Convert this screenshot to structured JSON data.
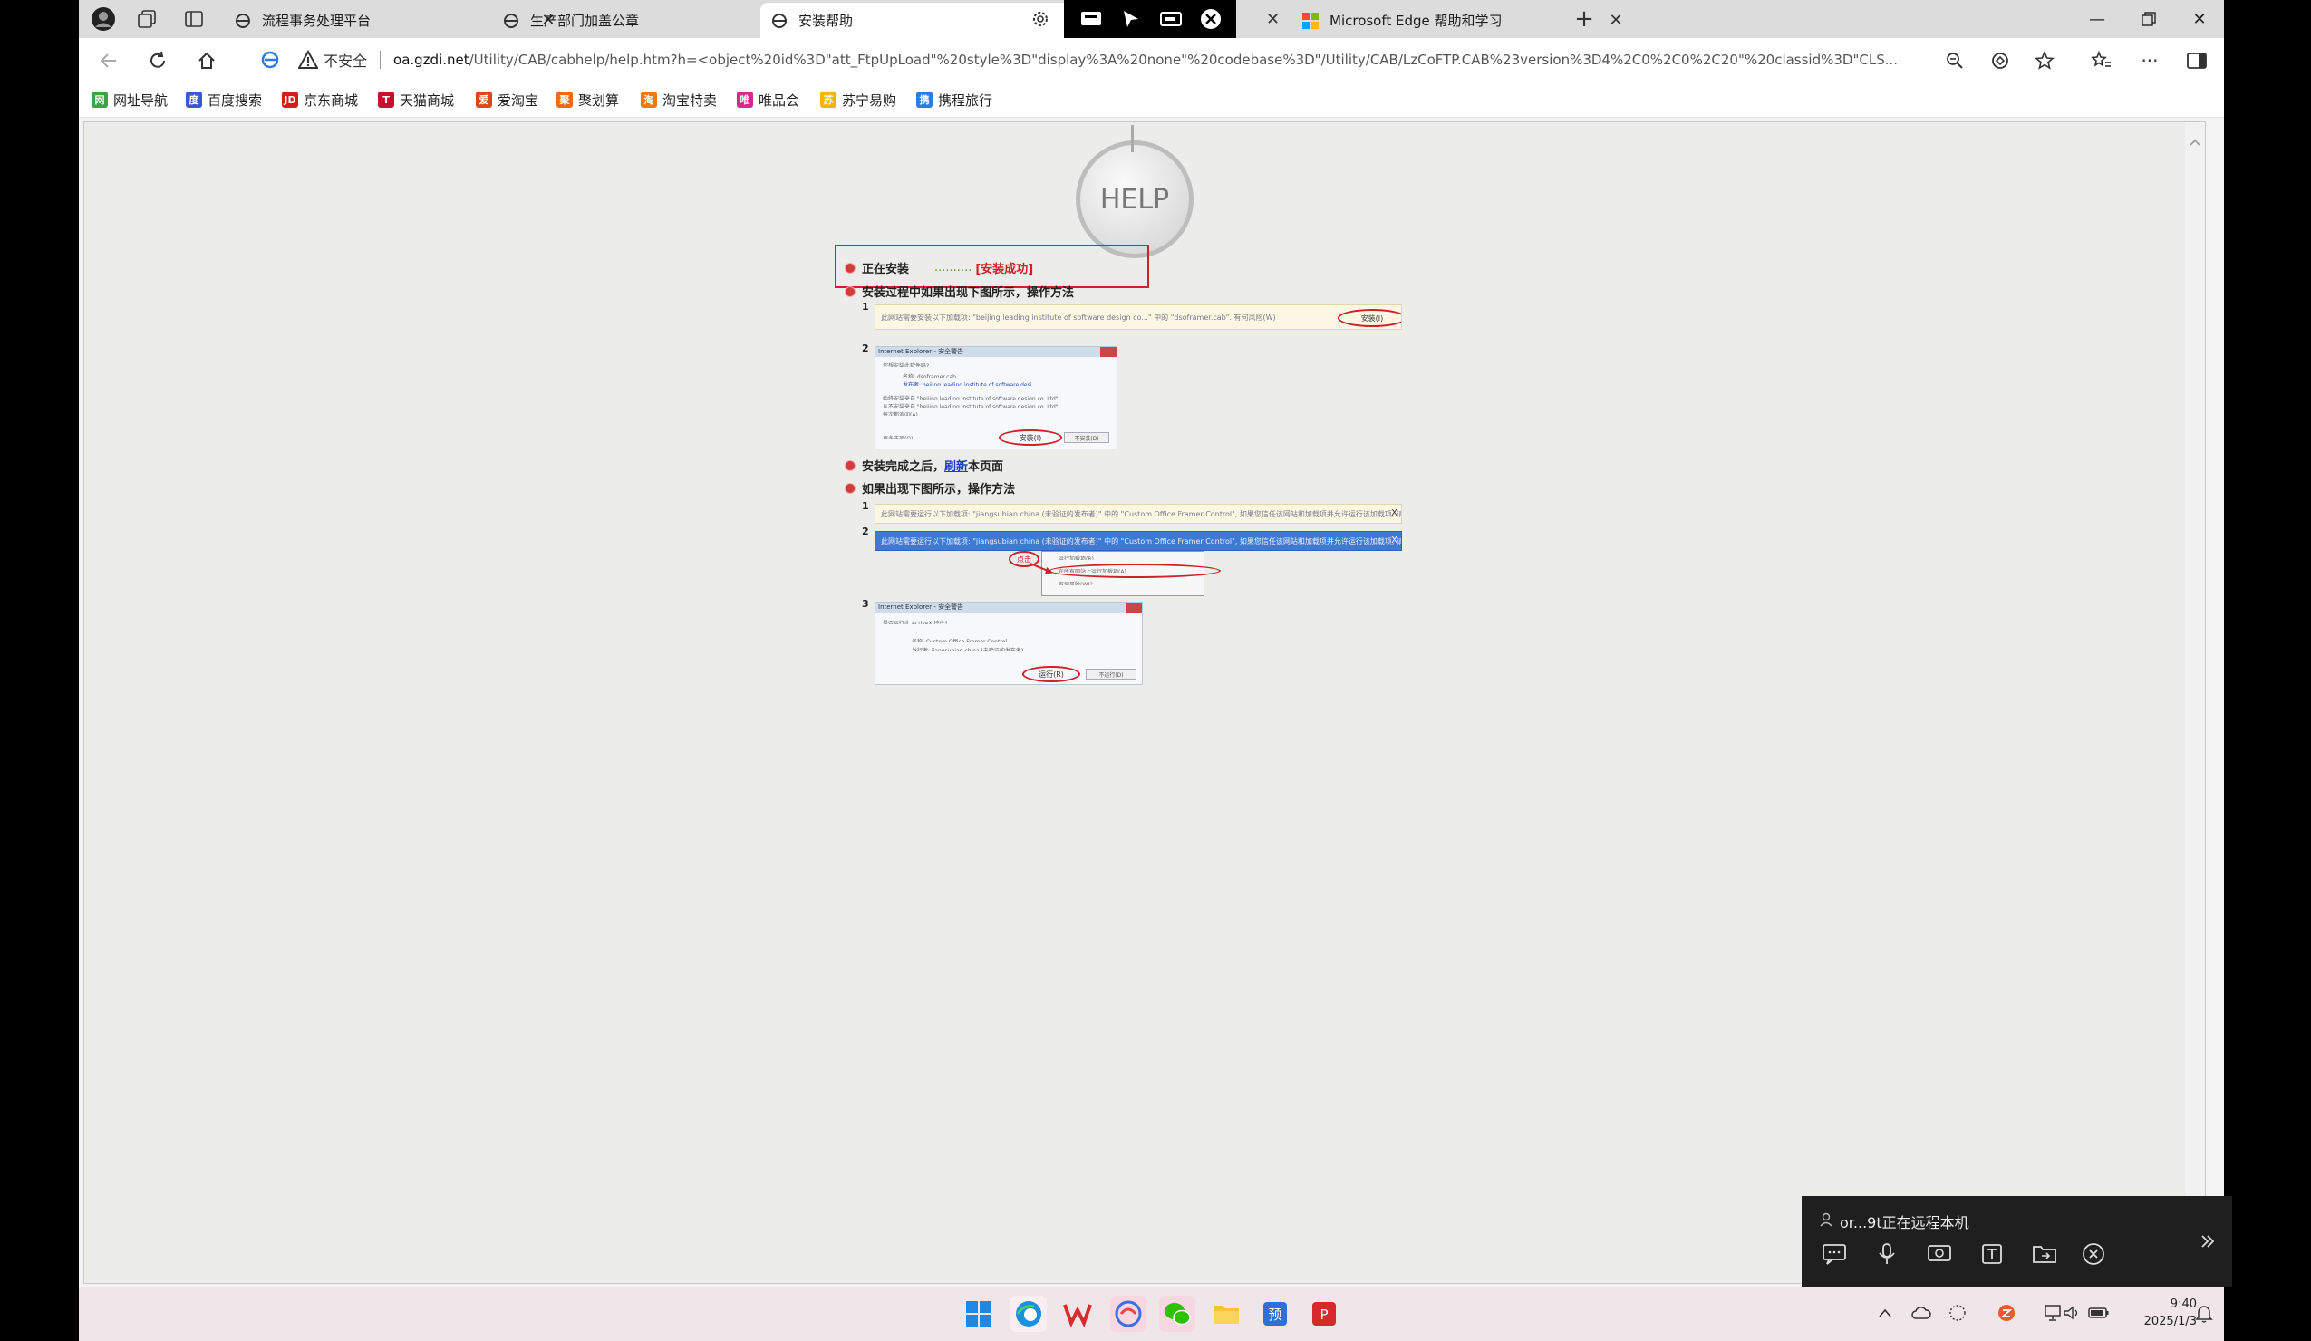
{
  "tabs": [
    {
      "title": "流程事务处理平台",
      "active": false
    },
    {
      "title": "生产部门加盖公章",
      "active": false
    },
    {
      "title": "安装帮助",
      "active": true
    },
    {
      "title": "Microsoft Edge 帮助和学习",
      "active": false
    }
  ],
  "address": {
    "security_label": "不安全",
    "url_host": "oa.gzdi.net",
    "url_path": "/Utility/CAB/cabhelp/help.htm?h=<object%20id%3D\"att_FtpUpLoad\"%20style%3D\"display%3A%20none\"%20codebase%3D\"/Utility/CAB/LzCoFTP.CAB%23version%3D4%2C0%2C0%2C20\"%20classid%3D\"CLS..."
  },
  "favorites": [
    {
      "label": "网址导航",
      "color": "#3aa34a",
      "glyph": "网"
    },
    {
      "label": "百度搜索",
      "color": "#3b57d6",
      "glyph": "度"
    },
    {
      "label": "京东商城",
      "color": "#d71a1a",
      "glyph": "JD"
    },
    {
      "label": "天猫商城",
      "color": "#c8102e",
      "glyph": "T"
    },
    {
      "label": "爱淘宝",
      "color": "#e0461c",
      "glyph": "爱"
    },
    {
      "label": "聚划算",
      "color": "#ef6a14",
      "glyph": "聚"
    },
    {
      "label": "淘宝特卖",
      "color": "#f07a10",
      "glyph": "淘"
    },
    {
      "label": "唯品会",
      "color": "#d9288d",
      "glyph": "唯"
    },
    {
      "label": "苏宁易购",
      "color": "#f4b400",
      "glyph": "苏"
    },
    {
      "label": "携程旅行",
      "color": "#2a7de1",
      "glyph": "携"
    }
  ],
  "help": {
    "logo_text": "HELP",
    "installing_label": "正在安装",
    "progress_dots": "..........",
    "success_label": "[安装成功]",
    "step_prompt_1": "安装过程中如果出现下图所示，操作方法",
    "step_refresh_prefix": "安装完成之后，",
    "step_refresh_link": "刷新",
    "step_refresh_suffix": "本页面",
    "step_prompt_2": "如果出现下图所示，操作方法",
    "shot1_text": "此网站需要安装以下加载项: \"beijing leading institute of software design co...\" 中的 \"dsoframer.cab\". 有何风险(W)",
    "shot1_button": "安装(I)",
    "dialog1_title": "Internet Explorer - 安全警告",
    "dialog1_question": "您想安装此软件吗?",
    "dialog1_name": "名称: dsoframer.cab",
    "dialog1_publisher": "发布者: beijing leading institute of software desi...",
    "dialog1_opt1": "始终安装来自 \"beijing leading institute of software design co.,Ltd\"",
    "dialog1_opt2": "从不安装来自 \"beijing leading institute of software design co.,Ltd\"",
    "dialog1_opt3": "每次都询问(A)",
    "dialog1_more": "更多选项(O)",
    "dialog1_install": "安装(I)",
    "dialog1_cancel": "不安装(D)",
    "bar2_text": "此网站需要运行以下加载项: \"jiangsubian china (未验证的发布者)\" 中的 \"Custom Office Framer Control\", 如果您信任该网站和加载项并允许运行该加载项, 请单击这里...",
    "bar2_close": "X",
    "bar3_text": "此网站需要运行以下加载项: \"jiangsubian china (未验证的发布者)\" 中的 \"Custom Office Framer Control\", 如果您信任该网站和加载项并允许运行该加载项, 请单击这里...",
    "click_label": "点击",
    "menu_item_1": "运行加载项(R)",
    "menu_item_2": "在所有网站上运行加载项(A)",
    "menu_item_3": "有何风险(W)?",
    "dialog2_title": "Internet Explorer - 安全警告",
    "dialog2_question": "是否运行此 ActiveX 控件?",
    "dialog2_name": "名称: Custom Office Framer Control",
    "dialog2_publisher": "发行者: jiangsubian china (未验证的发布者)",
    "dialog2_run": "运行(R)",
    "dialog2_norun": "不运行(D)",
    "num1": "1",
    "num2": "2",
    "num3": "3"
  },
  "remote": {
    "status": "or...9t正在远程本机"
  },
  "clock": {
    "time": "9:40",
    "date": "2025/1/3"
  }
}
